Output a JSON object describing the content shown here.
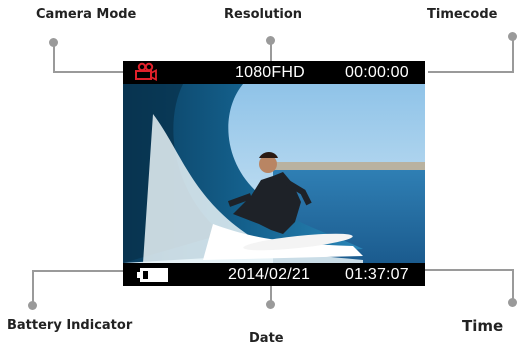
{
  "callouts": {
    "camera_mode": "Camera Mode",
    "resolution": "Resolution",
    "timecode": "Timecode",
    "battery_indicator": "Battery Indicator",
    "date": "Date",
    "time": "Time"
  },
  "screen": {
    "resolution": "1080FHD",
    "timecode": "00:00:00",
    "date": "2014/02/21",
    "time": "01:37:07",
    "camera_mode_icon": "video-camera-icon",
    "battery_icon": "battery-icon"
  },
  "colors": {
    "camera_icon": "#e0212b",
    "osd_text": "#ffffff",
    "osd_bar": "#000000",
    "lead_lines": "#9a9a9a"
  }
}
